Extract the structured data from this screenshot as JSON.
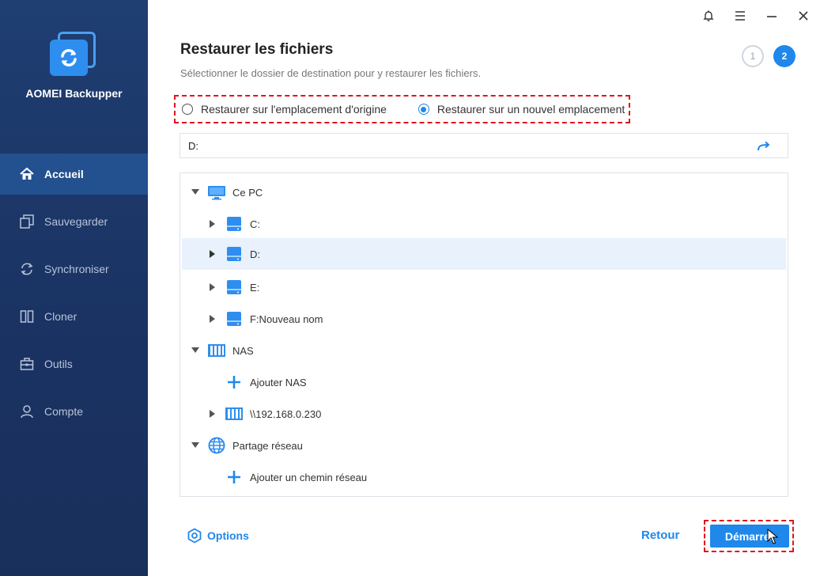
{
  "app": {
    "name": "AOMEI Backupper"
  },
  "sidebar": {
    "items": [
      {
        "label": "Accueil",
        "icon": "home-icon",
        "active": true
      },
      {
        "label": "Sauvegarder",
        "icon": "backup-icon"
      },
      {
        "label": "Synchroniser",
        "icon": "sync-icon"
      },
      {
        "label": "Cloner",
        "icon": "clone-icon"
      },
      {
        "label": "Outils",
        "icon": "toolbox-icon"
      },
      {
        "label": "Compte",
        "icon": "user-icon"
      }
    ]
  },
  "page": {
    "title": "Restaurer les fichiers",
    "subtitle": "Sélectionner le dossier de destination pour y restaurer les fichiers.",
    "steps": [
      "1",
      "2"
    ],
    "current_step": 2
  },
  "restore_options": {
    "original": "Restaurer sur l'emplacement d'origine",
    "new": "Restaurer sur un nouvel emplacement",
    "selected": "new"
  },
  "path": {
    "value": "D:"
  },
  "tree": {
    "ce_pc": "Ce PC",
    "drive_c": "C:",
    "drive_d": "D:",
    "drive_e": "E:",
    "drive_f": "F:Nouveau nom",
    "nas": "NAS",
    "add_nas": "Ajouter NAS",
    "nas_ip": "\\\\192.168.0.230",
    "network_share": "Partage réseau",
    "add_network_path": "Ajouter un chemin réseau",
    "selected": "D:"
  },
  "footer": {
    "options": "Options",
    "back": "Retour",
    "start": "Démarrer"
  },
  "colors": {
    "accent": "#1f88ea",
    "sidebar_bg": "#1a3363",
    "sidebar_active": "#23508f",
    "highlight_dashed": "#e0141e",
    "selected_row": "#e8f1fc"
  }
}
